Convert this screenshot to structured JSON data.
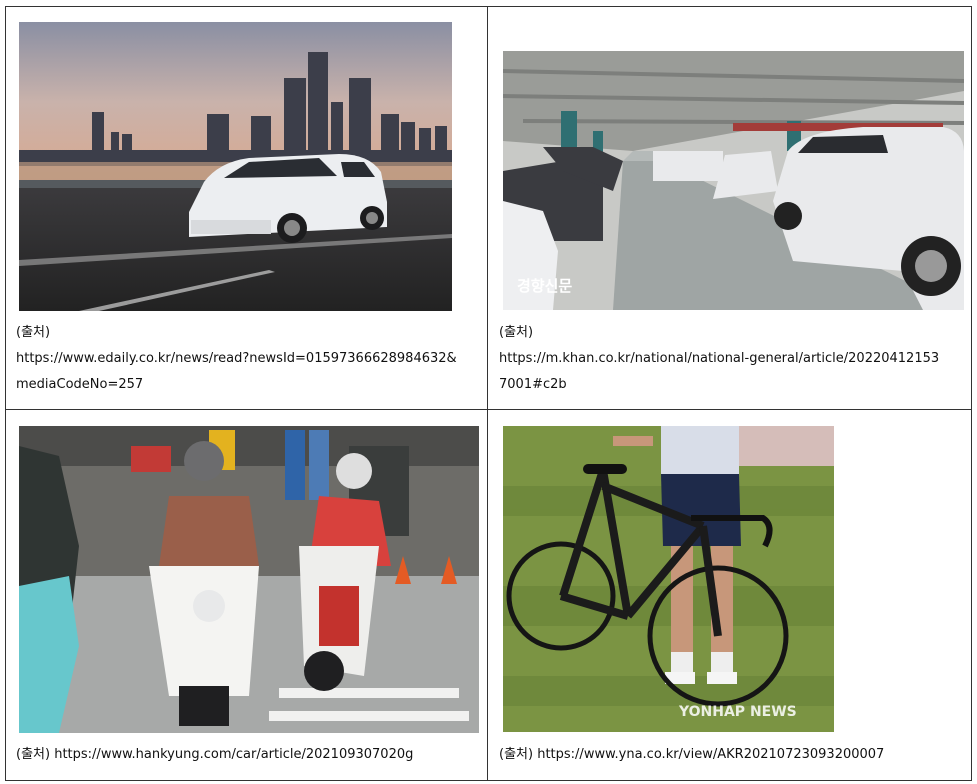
{
  "cells": [
    {
      "label": "(출처)",
      "url_line1": "https://www.edaily.co.kr/news/read?newsId=01597366628984632&",
      "url_line2": "mediaCodeNo=257",
      "image": "white SUV driving on highway with city skyline at sunset"
    },
    {
      "label": "(출처)",
      "url_line1": "https://m.khan.co.kr/national/national-general/article/20220412153",
      "url_line2": "7001#c2b",
      "image": "underground parking garage with parked cars",
      "watermark": "경향신문"
    },
    {
      "label": "(출처)",
      "url": "https://www.hankyung.com/car/article/202109307020g",
      "image": "delivery riders on scooters in city street"
    },
    {
      "label": "(출처)",
      "url": "https://www.yna.co.kr/view/AKR20210723093200007",
      "image": "person standing with black road bicycle on grass",
      "watermark": "YONHAP NEWS"
    }
  ],
  "colors": {
    "border": "#333333",
    "text": "#111111"
  }
}
